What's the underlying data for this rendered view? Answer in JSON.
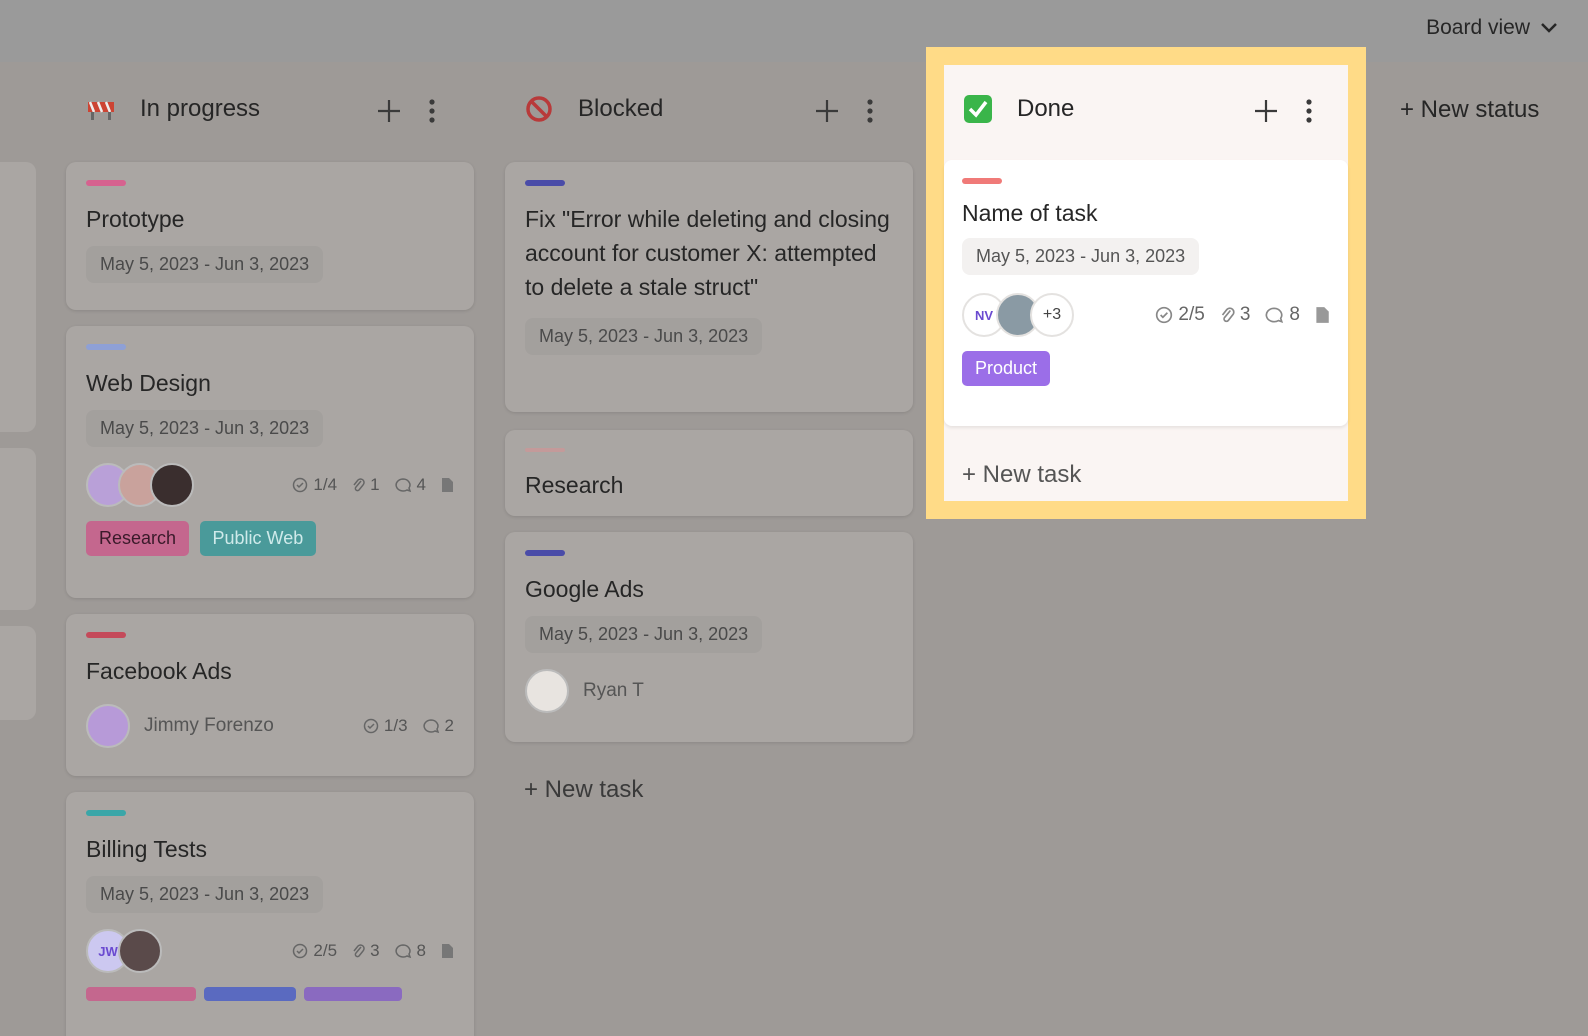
{
  "header": {
    "view_label": "Board view"
  },
  "columns": {
    "in_progress": {
      "title": "In progress",
      "cards": [
        {
          "title": "Prototype",
          "date": "May 5, 2023 - Jun 3, 2023",
          "bar_color": "#d6628f"
        },
        {
          "title": "Web Design",
          "date": "May 5, 2023 - Jun 3, 2023",
          "bar_color": "#8ea0d6",
          "checks": "1/4",
          "attachments": "1",
          "comments": "4",
          "tags": [
            {
              "label": "Research",
              "color": "#e06aa0"
            },
            {
              "label": "Public Web",
              "color": "#3aa6a8"
            }
          ]
        },
        {
          "title": "Facebook Ads",
          "assignee": "Jimmy Forenzo",
          "checks": "1/3",
          "comments": "2",
          "bar_color": "#d44a5a"
        },
        {
          "title": "Billing Tests",
          "date": "May 5, 2023 - Jun 3, 2023",
          "bar_color": "#3aa6a8",
          "avatar_initials": "JW",
          "checks": "2/5",
          "attachments": "3",
          "comments": "8"
        }
      ]
    },
    "blocked": {
      "title": "Blocked",
      "cards": [
        {
          "title": "Fix \"Error while deleting and closing account for customer X: attempted to delete a stale struct\"",
          "date": "May 5, 2023 - Jun 3, 2023",
          "bar_color": "#4a4ca8"
        },
        {
          "title": "Research",
          "bar_color": "#d49a9a"
        },
        {
          "title": "Google Ads",
          "date": "May 5, 2023 - Jun 3, 2023",
          "assignee": "Ryan T",
          "bar_color": "#4a4ca8"
        }
      ],
      "new_task": "+ New task"
    },
    "done": {
      "title": "Done",
      "cards": [
        {
          "title": "Name of task",
          "date": "May 5, 2023 - Jun 3, 2023",
          "bar_color": "#f07a78",
          "avatar_initials": "NV",
          "extra_count": "+3",
          "checks": "2/5",
          "attachments": "3",
          "comments": "8",
          "tags": [
            {
              "label": "Product",
              "color": "#9b6ee8"
            }
          ]
        }
      ],
      "new_task": "+ New task"
    }
  },
  "new_status": "+ New status"
}
